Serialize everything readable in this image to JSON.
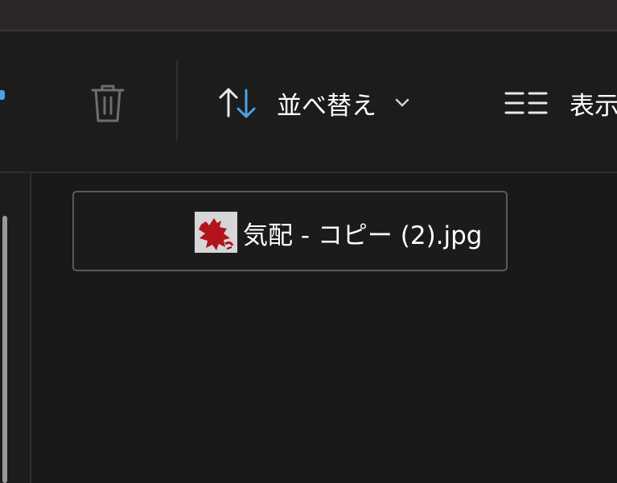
{
  "window": {
    "colors": {
      "titlebar": "#2b2729",
      "toolbar": "#1c1c1c",
      "content": "#191919",
      "accent": "#4aa3e8"
    }
  },
  "toolbar": {
    "delete_icon": "trash-icon",
    "sort": {
      "icon": "sort-arrows-icon",
      "label": "並べ替え",
      "chevron": "chevron-down-icon"
    },
    "view": {
      "icon": "view-list-icon",
      "label": "表示"
    }
  },
  "files": [
    {
      "name": "気配 - コピー (2).jpg",
      "thumbnail": "image-thumbnail",
      "selected": true
    }
  ]
}
